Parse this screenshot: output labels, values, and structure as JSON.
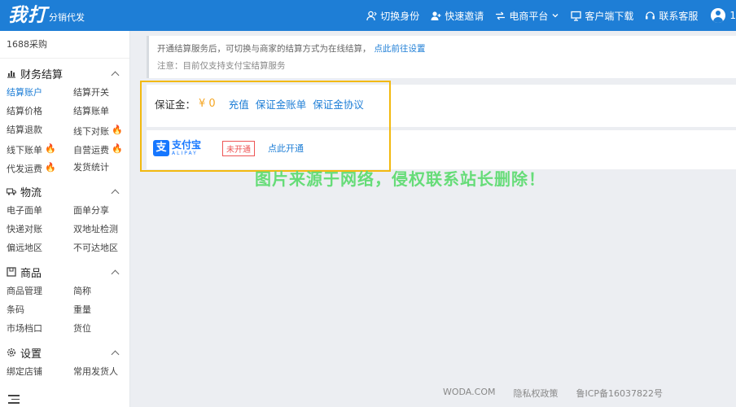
{
  "brand": {
    "logo_main": "我打",
    "logo_sub": "分销代发"
  },
  "nav": [
    {
      "label": "切换身份",
      "icon": "user-switch-icon"
    },
    {
      "label": "快速邀请",
      "icon": "user-add-icon"
    },
    {
      "label": "电商平台",
      "icon": "exchange-icon"
    },
    {
      "label": "客户端下载",
      "icon": "monitor-icon"
    },
    {
      "label": "联系客服",
      "icon": "headset-icon"
    }
  ],
  "user": {
    "label": "1"
  },
  "sidebar": {
    "top_label": "1688采购",
    "sections": [
      {
        "title": "财务结算",
        "icon": "bar-chart-icon",
        "items": [
          {
            "label": "结算账户"
          },
          {
            "label": "结算开关"
          },
          {
            "label": "结算价格"
          },
          {
            "label": "结算账单"
          },
          {
            "label": "结算退款"
          },
          {
            "label": "线下对账"
          },
          {
            "label": "线下账单"
          },
          {
            "label": "自营运费"
          },
          {
            "label": "代发运费"
          },
          {
            "label": "发货统计"
          }
        ]
      },
      {
        "title": "物流",
        "icon": "truck-icon",
        "items": [
          {
            "label": "电子面单"
          },
          {
            "label": "面单分享"
          },
          {
            "label": "快递对账"
          },
          {
            "label": "双地址检测"
          },
          {
            "label": "偏远地区"
          },
          {
            "label": "不可达地区"
          }
        ]
      },
      {
        "title": "商品",
        "icon": "box-icon",
        "items": [
          {
            "label": "商品管理"
          },
          {
            "label": "简称"
          },
          {
            "label": "条码"
          },
          {
            "label": "重量"
          },
          {
            "label": "市场档口"
          },
          {
            "label": "货位"
          }
        ]
      },
      {
        "title": "设置",
        "icon": "gear-icon",
        "items": [
          {
            "label": "绑定店铺"
          },
          {
            "label": "常用发货人"
          }
        ]
      }
    ]
  },
  "notice": {
    "line1": "开通结算服务后，可切换与商家的结算方式为在线结算，",
    "line1_link": "点此前往设置",
    "line2": "注意：目前仅支持支付宝结算服务"
  },
  "deposit": {
    "label": "保证金：",
    "amount": "¥ 0",
    "links": [
      "充值",
      "保证金账单",
      "保证金协议"
    ]
  },
  "alipay": {
    "logo_cn": "支付宝",
    "logo_en": "ALIPAY",
    "status": "未开通",
    "action": "点此开通"
  },
  "watermark": "图片来源于网络，侵权联系站长删除！",
  "footer": [
    "WODA.COM",
    "隐私权政策",
    "鲁ICP备16037822号"
  ],
  "colors": {
    "primary": "#1e7ed6",
    "highlight": "#f2b90f",
    "amount": "#f5a623",
    "fire": "#f5a623",
    "watermark": "#5fdc72",
    "status_off": "#e55555"
  }
}
